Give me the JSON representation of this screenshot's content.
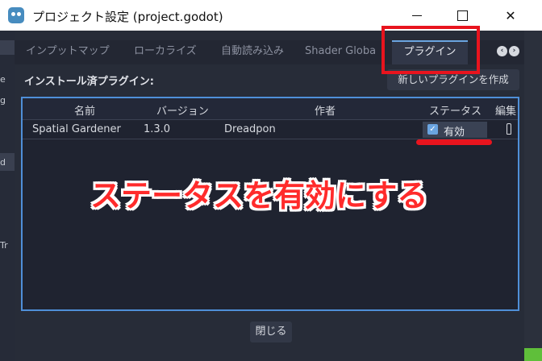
{
  "window": {
    "title": "プロジェクト設定 (project.godot)",
    "minimize": "",
    "maximize": "",
    "close": "✕"
  },
  "tabs": [
    {
      "label": "インプットマップ",
      "active": false
    },
    {
      "label": "ローカライズ",
      "active": false
    },
    {
      "label": "自動読み込み",
      "active": false
    },
    {
      "label": "Shader Globa",
      "active": false
    },
    {
      "label": "プラグイン",
      "active": true
    }
  ],
  "tab_arrows": [
    "‹",
    "›"
  ],
  "plugins": {
    "section_label": "インストール済プラグイン:",
    "create_button": "新しいプラグインを作成",
    "columns": [
      "名前",
      "バージョン",
      "作者",
      "ステータス",
      "編集"
    ],
    "rows": [
      {
        "name": "Spatial Gardener",
        "version": "1.3.0",
        "author": "Dreadpon",
        "status": "有効",
        "enabled": true
      }
    ]
  },
  "close_button": "閉じる",
  "annotation": {
    "text": "ステータスを有効にする",
    "color": "#e8141e"
  },
  "background_fragments": [
    "e",
    "g",
    "d",
    "Tr"
  ]
}
